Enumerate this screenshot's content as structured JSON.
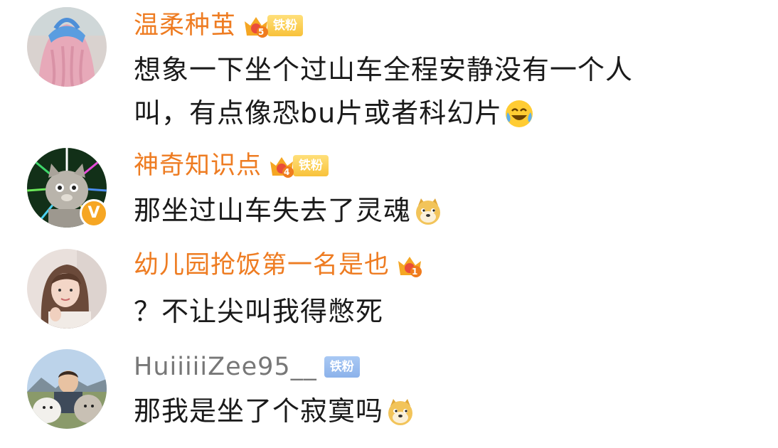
{
  "comments": [
    {
      "username": "温柔种茧",
      "crown_level": "5",
      "fan_badge": "铁粉",
      "lines": [
        "想象一下坐个过山车全程安静没有一个人",
        "叫，有点像恐bu片或者科幻片"
      ],
      "emoji": "laugh-cry-emoji"
    },
    {
      "username": "神奇知识点",
      "crown_level": "4",
      "fan_badge": "铁粉",
      "lines": [
        "那坐过山车失去了灵魂"
      ],
      "emoji": "doge-emoji"
    },
    {
      "username": "幼儿园抢饭第一名是也",
      "crown_level": "1",
      "lines": [
        "？不让尖叫我得憋死"
      ]
    },
    {
      "username": "HuiiiiiZee95__",
      "fan_badge": "铁粉",
      "lines": [
        "那我是坐了个寂寞吗"
      ],
      "emoji": "doge-emoji"
    }
  ],
  "colors": {
    "vip_name": "#ee7c22",
    "normal_name": "#777777",
    "text": "#1a1a1a",
    "gold_badge": "#f8c23a",
    "blue_badge": "#8cb2ea"
  }
}
